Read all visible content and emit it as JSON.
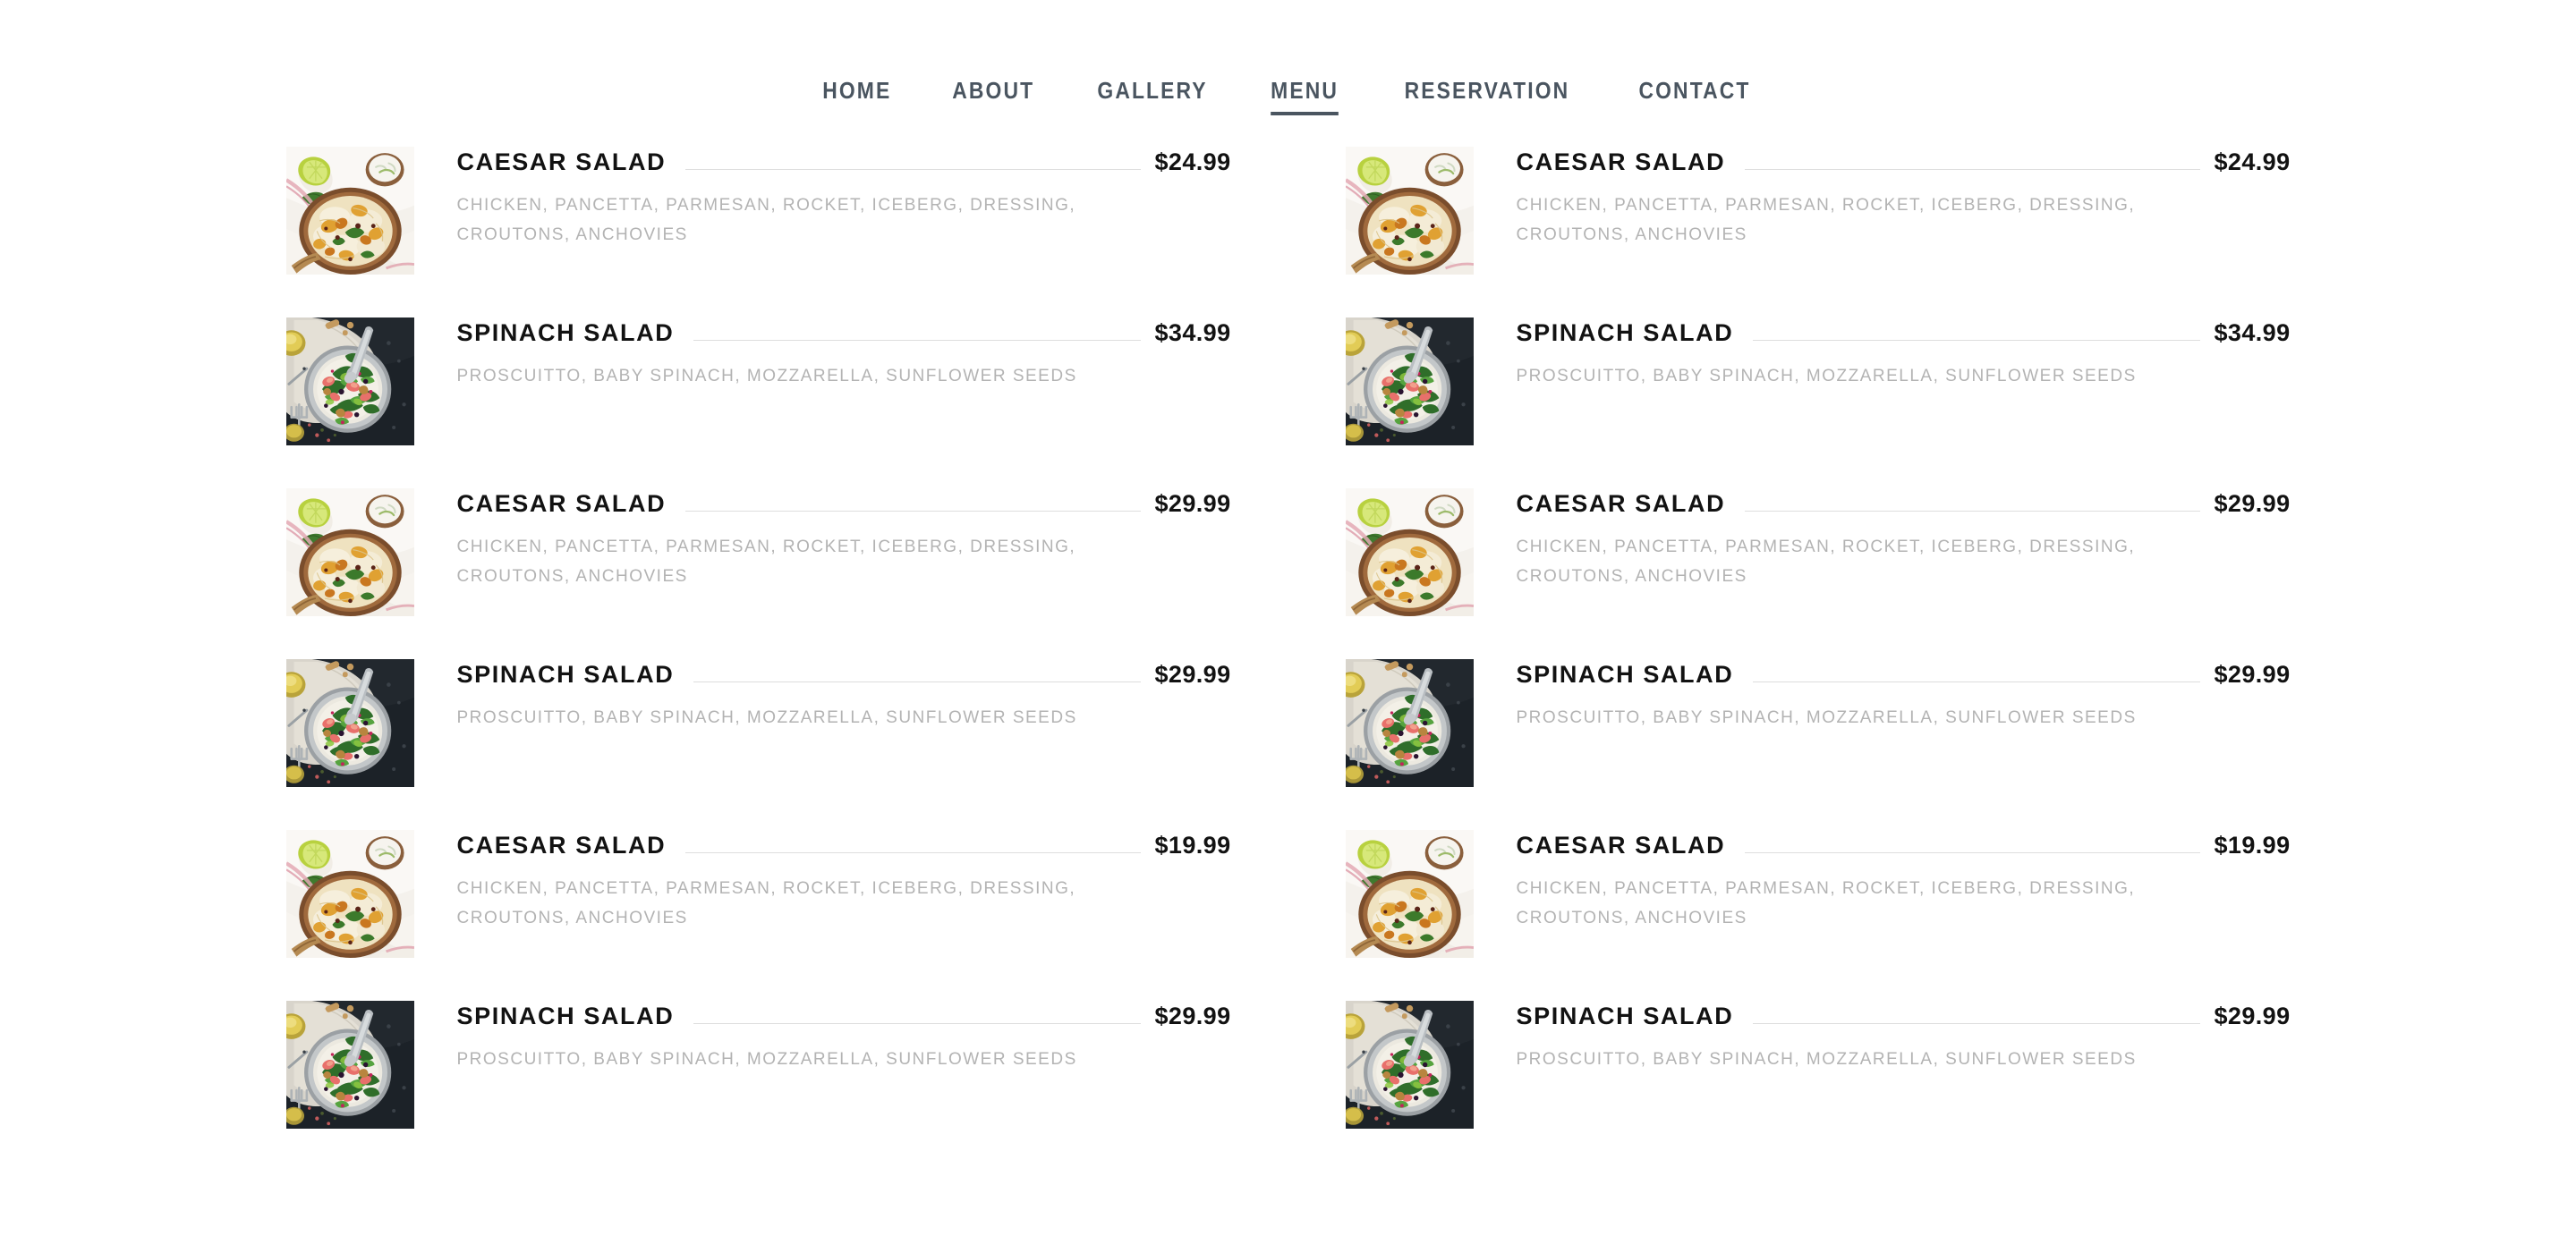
{
  "nav": {
    "items": [
      {
        "label": "HOME",
        "active": false
      },
      {
        "label": "ABOUT",
        "active": false
      },
      {
        "label": "GALLERY",
        "active": false
      },
      {
        "label": "MENU",
        "active": true
      },
      {
        "label": "RESERVATION",
        "active": false
      },
      {
        "label": "CONTACT",
        "active": false
      }
    ],
    "color": "#4a5560",
    "active_underline_color": "#4a5560"
  },
  "colors": {
    "background": "#ffffff",
    "title": "#121212",
    "price": "#121212",
    "description": "#b3b3b3",
    "leader_line": "#dedede"
  },
  "menu": {
    "columns": 2,
    "items": [
      {
        "name": "CAESAR SALAD",
        "price": "$24.99",
        "description": "CHICKEN, PANCETTA, PARMESAN, ROCKET, ICEBERG, DRESSING, CROUTONS, ANCHOVIES",
        "image": "biryani-rice-bowl-photo",
        "column": "left",
        "row": 1
      },
      {
        "name": "CAESAR SALAD",
        "price": "$24.99",
        "description": "CHICKEN, PANCETTA, PARMESAN, ROCKET, ICEBERG, DRESSING, CROUTONS, ANCHOVIES",
        "image": "biryani-rice-bowl-photo",
        "column": "right",
        "row": 1
      },
      {
        "name": "SPINACH SALAD",
        "price": "$34.99",
        "description": "PROSCUITTO, BABY SPINACH, MOZZARELLA, SUNFLOWER SEEDS",
        "image": "spinach-salad-plate-photo",
        "column": "left",
        "row": 2
      },
      {
        "name": "SPINACH SALAD",
        "price": "$34.99",
        "description": "PROSCUITTO, BABY SPINACH, MOZZARELLA, SUNFLOWER SEEDS",
        "image": "spinach-salad-plate-photo",
        "column": "right",
        "row": 2
      },
      {
        "name": "CAESAR SALAD",
        "price": "$29.99",
        "description": "CHICKEN, PANCETTA, PARMESAN, ROCKET, ICEBERG, DRESSING, CROUTONS, ANCHOVIES",
        "image": "biryani-rice-bowl-photo",
        "column": "left",
        "row": 3
      },
      {
        "name": "CAESAR SALAD",
        "price": "$29.99",
        "description": "CHICKEN, PANCETTA, PARMESAN, ROCKET, ICEBERG, DRESSING, CROUTONS, ANCHOVIES",
        "image": "biryani-rice-bowl-photo",
        "column": "right",
        "row": 3
      },
      {
        "name": "SPINACH SALAD",
        "price": "$29.99",
        "description": "PROSCUITTO, BABY SPINACH, MOZZARELLA, SUNFLOWER SEEDS",
        "image": "spinach-salad-plate-photo",
        "column": "left",
        "row": 4
      },
      {
        "name": "SPINACH SALAD",
        "price": "$29.99",
        "description": "PROSCUITTO, BABY SPINACH, MOZZARELLA, SUNFLOWER SEEDS",
        "image": "spinach-salad-plate-photo",
        "column": "right",
        "row": 4
      },
      {
        "name": "CAESAR SALAD",
        "price": "$19.99",
        "description": "CHICKEN, PANCETTA, PARMESAN, ROCKET, ICEBERG, DRESSING, CROUTONS, ANCHOVIES",
        "image": "biryani-rice-bowl-photo",
        "column": "left",
        "row": 5
      },
      {
        "name": "CAESAR SALAD",
        "price": "$19.99",
        "description": "CHICKEN, PANCETTA, PARMESAN, ROCKET, ICEBERG, DRESSING, CROUTONS, ANCHOVIES",
        "image": "biryani-rice-bowl-photo",
        "column": "right",
        "row": 5
      },
      {
        "name": "SPINACH SALAD",
        "price": "$29.99",
        "description": "PROSCUITTO, BABY SPINACH, MOZZARELLA, SUNFLOWER SEEDS",
        "image": "spinach-salad-plate-photo",
        "column": "left",
        "row": 6
      },
      {
        "name": "SPINACH SALAD",
        "price": "$29.99",
        "description": "PROSCUITTO, BABY SPINACH, MOZZARELLA, SUNFLOWER SEEDS",
        "image": "spinach-salad-plate-photo",
        "column": "right",
        "row": 6
      }
    ]
  }
}
